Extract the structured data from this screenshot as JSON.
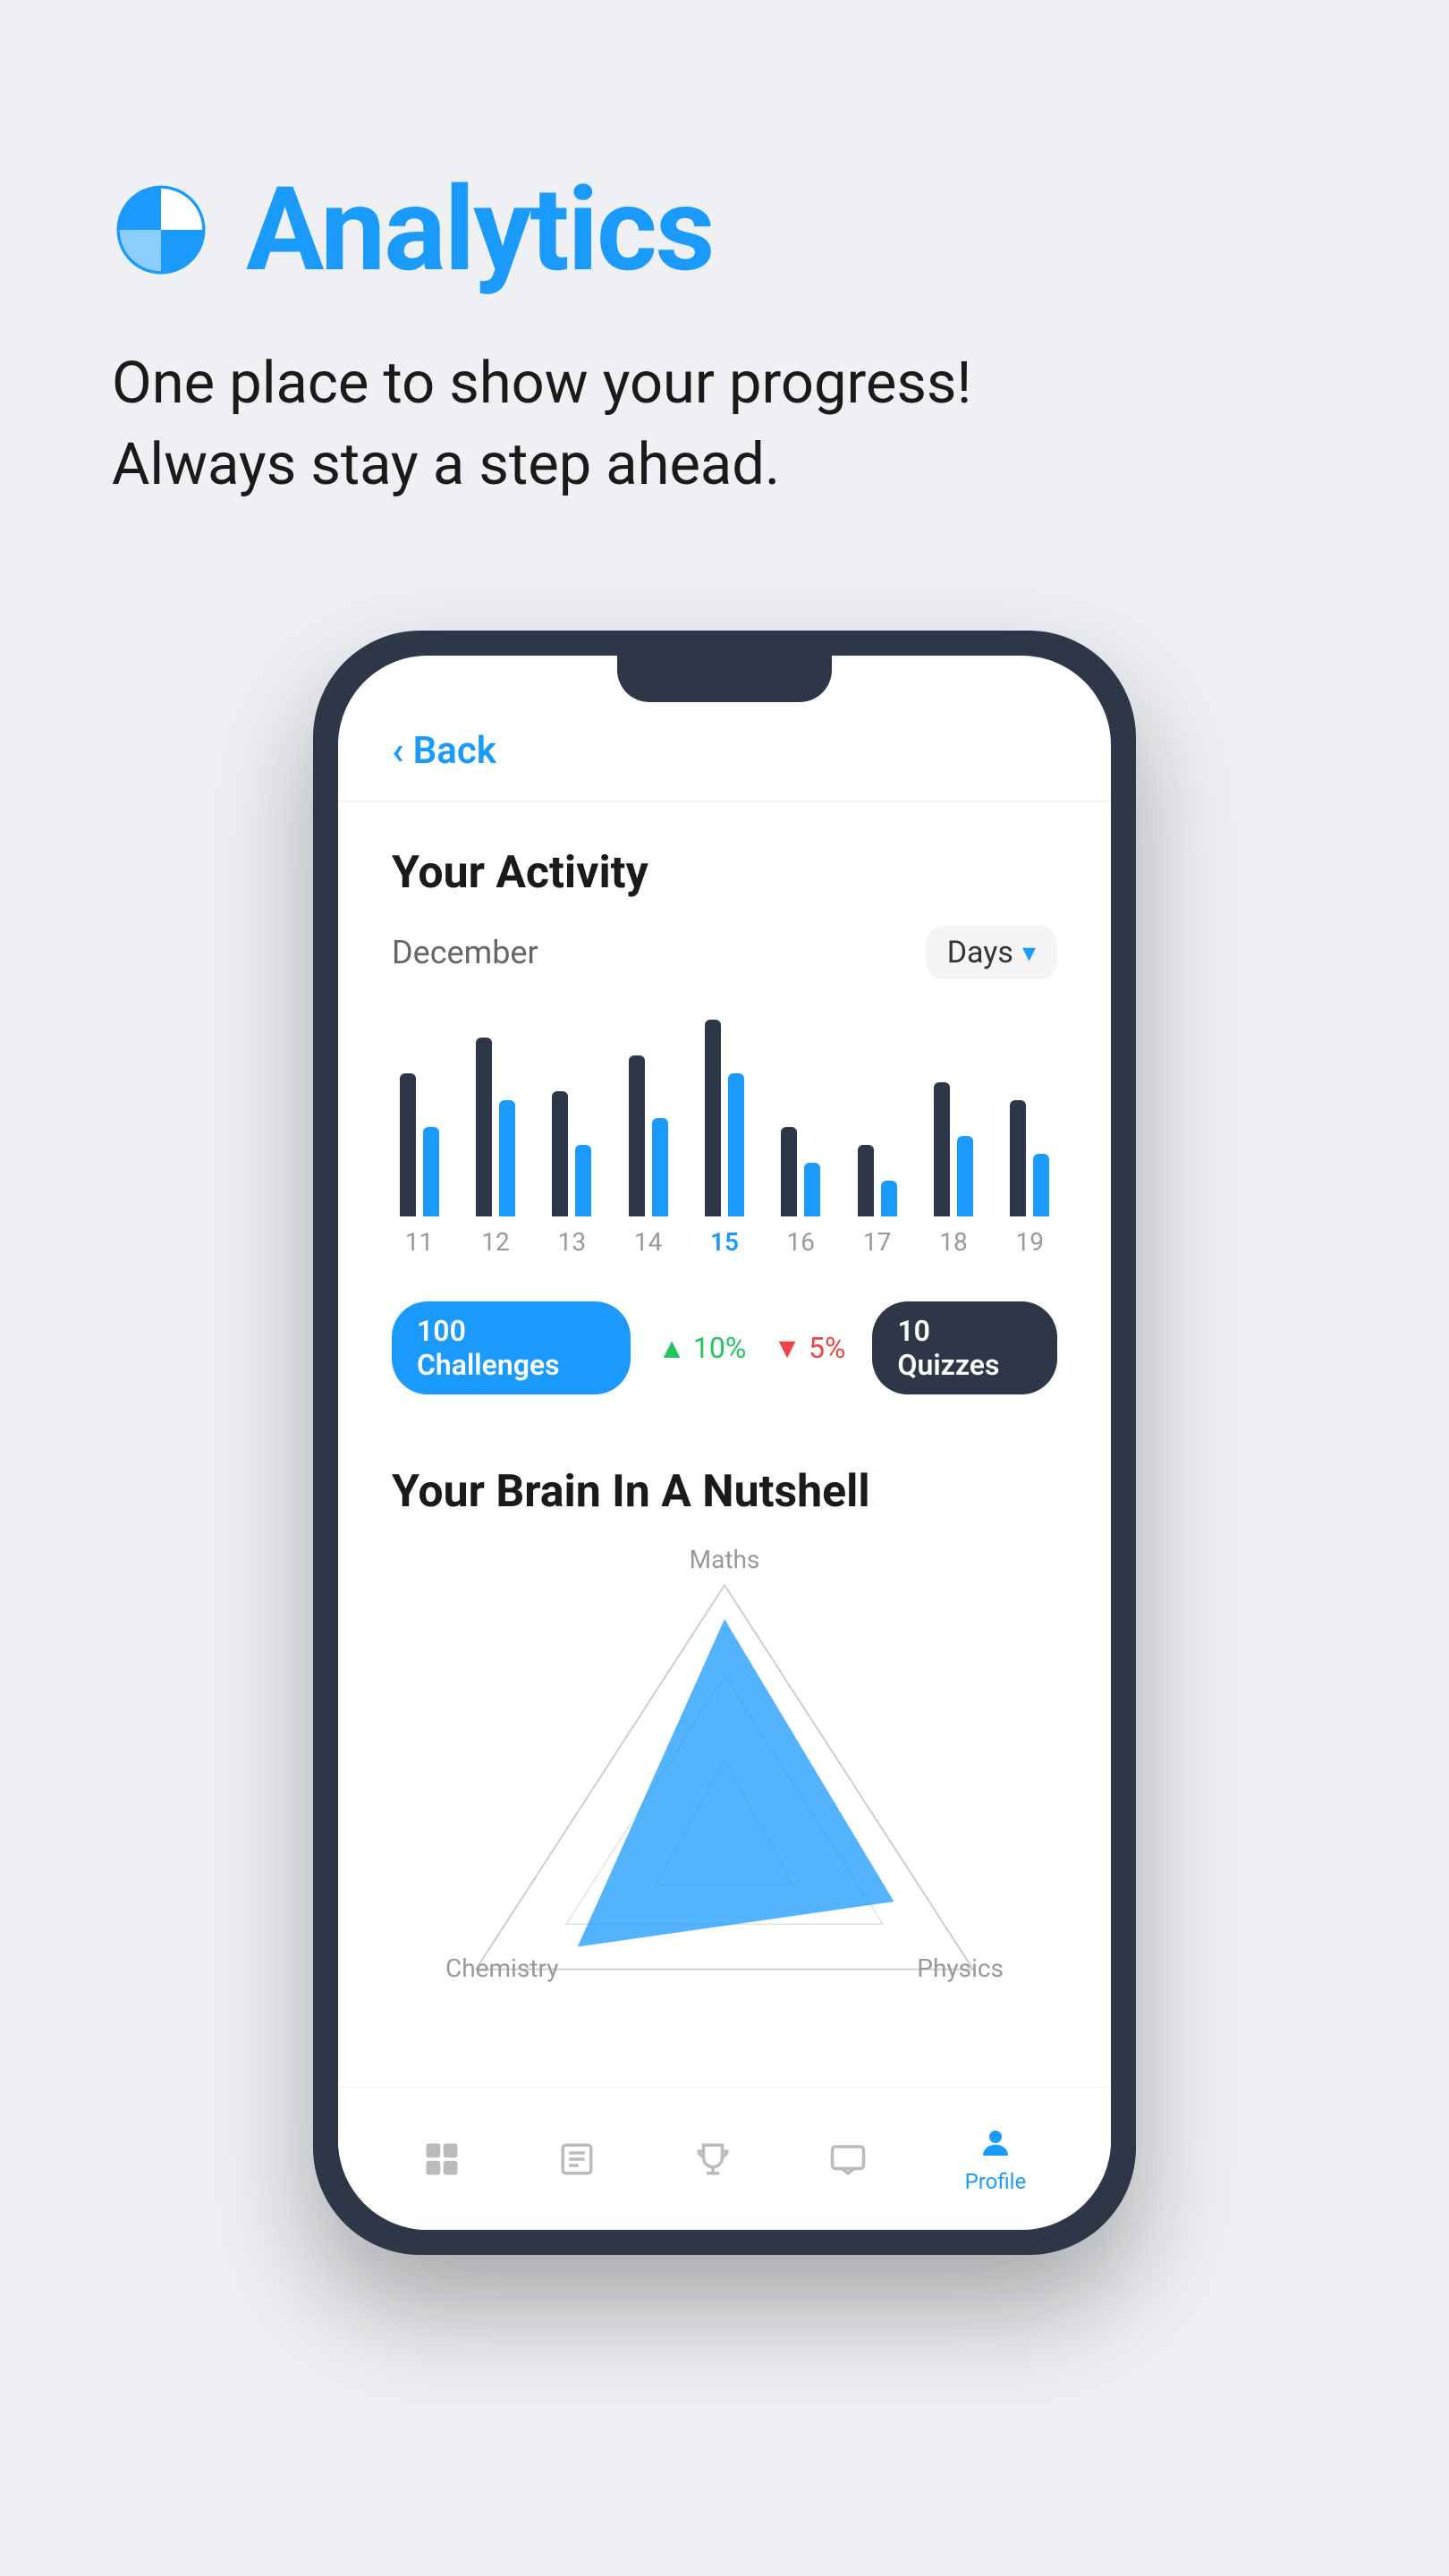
{
  "header": {
    "title": "Analytics",
    "subtitle_line1": "One place to show your progress!",
    "subtitle_line2": "Always stay a step ahead."
  },
  "phone": {
    "back_label": "Back",
    "activity": {
      "title": "Your Activity",
      "month": "December",
      "period_selector": "Days",
      "bars": [
        {
          "day": "11",
          "dark_height": 160,
          "blue_height": 100,
          "active": false
        },
        {
          "day": "12",
          "dark_height": 200,
          "blue_height": 130,
          "active": false
        },
        {
          "day": "13",
          "dark_height": 140,
          "blue_height": 80,
          "active": false
        },
        {
          "day": "14",
          "dark_height": 180,
          "blue_height": 110,
          "active": false
        },
        {
          "day": "15",
          "dark_height": 220,
          "blue_height": 160,
          "active": true
        },
        {
          "day": "16",
          "dark_height": 100,
          "blue_height": 60,
          "active": false
        },
        {
          "day": "17",
          "dark_height": 80,
          "blue_height": 40,
          "active": false
        },
        {
          "day": "18",
          "dark_height": 150,
          "blue_height": 90,
          "active": false
        },
        {
          "day": "19",
          "dark_height": 130,
          "blue_height": 70,
          "active": false
        }
      ],
      "stats": {
        "challenges_count": "100",
        "challenges_label": "Challenges",
        "percent_up": "10%",
        "percent_down": "5%",
        "quizzes_count": "10",
        "quizzes_label": "Quizzes"
      }
    },
    "brain": {
      "title": "Your Brain In A Nutshell",
      "labels": {
        "top": "Maths",
        "bottom_left": "Chemistry",
        "bottom_right": "Physics"
      }
    },
    "bottom_nav": {
      "items": [
        {
          "label": "",
          "icon": "⊞",
          "active": false,
          "name": "home"
        },
        {
          "label": "",
          "icon": "📖",
          "active": false,
          "name": "courses"
        },
        {
          "label": "",
          "icon": "🏆",
          "active": false,
          "name": "achievements"
        },
        {
          "label": "",
          "icon": "💬",
          "active": false,
          "name": "messages"
        },
        {
          "label": "Profile",
          "icon": "👤",
          "active": true,
          "name": "profile"
        }
      ]
    }
  },
  "colors": {
    "blue": "#1a9bfc",
    "dark": "#2d3748",
    "green": "#22c55e",
    "red": "#ef4444",
    "bg": "#eef0f3"
  }
}
